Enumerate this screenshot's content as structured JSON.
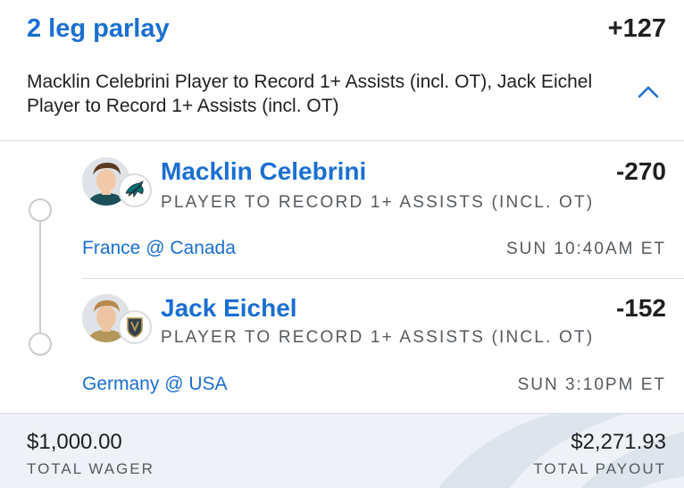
{
  "header": {
    "title": "2 leg parlay",
    "odds": "+127",
    "description": "Macklin Celebrini Player to Record 1+ Assists (incl. OT), Jack Eichel Player to Record 1+ Assists (incl. OT)"
  },
  "legs": [
    {
      "player": "Macklin Celebrini",
      "market": "PLAYER TO RECORD 1+ ASSISTS (INCL. OT)",
      "odds": "-270",
      "event": "France @ Canada",
      "time": "SUN 10:40AM ET",
      "team_icon": "sharks-logo-icon"
    },
    {
      "player": "Jack Eichel",
      "market": "PLAYER TO RECORD 1+ ASSISTS (INCL. OT)",
      "odds": "-152",
      "event": "Germany @ USA",
      "time": "SUN 3:10PM ET",
      "team_icon": "golden-knights-logo-icon"
    }
  ],
  "footer": {
    "wager_amount": "$1,000.00",
    "wager_label": "TOTAL WAGER",
    "payout_amount": "$2,271.93",
    "payout_label": "TOTAL PAYOUT"
  },
  "colors": {
    "accent": "#1a6fd1",
    "text": "#1f1f1f",
    "muted": "#555a60",
    "footer_bg": "#eef2f6"
  }
}
